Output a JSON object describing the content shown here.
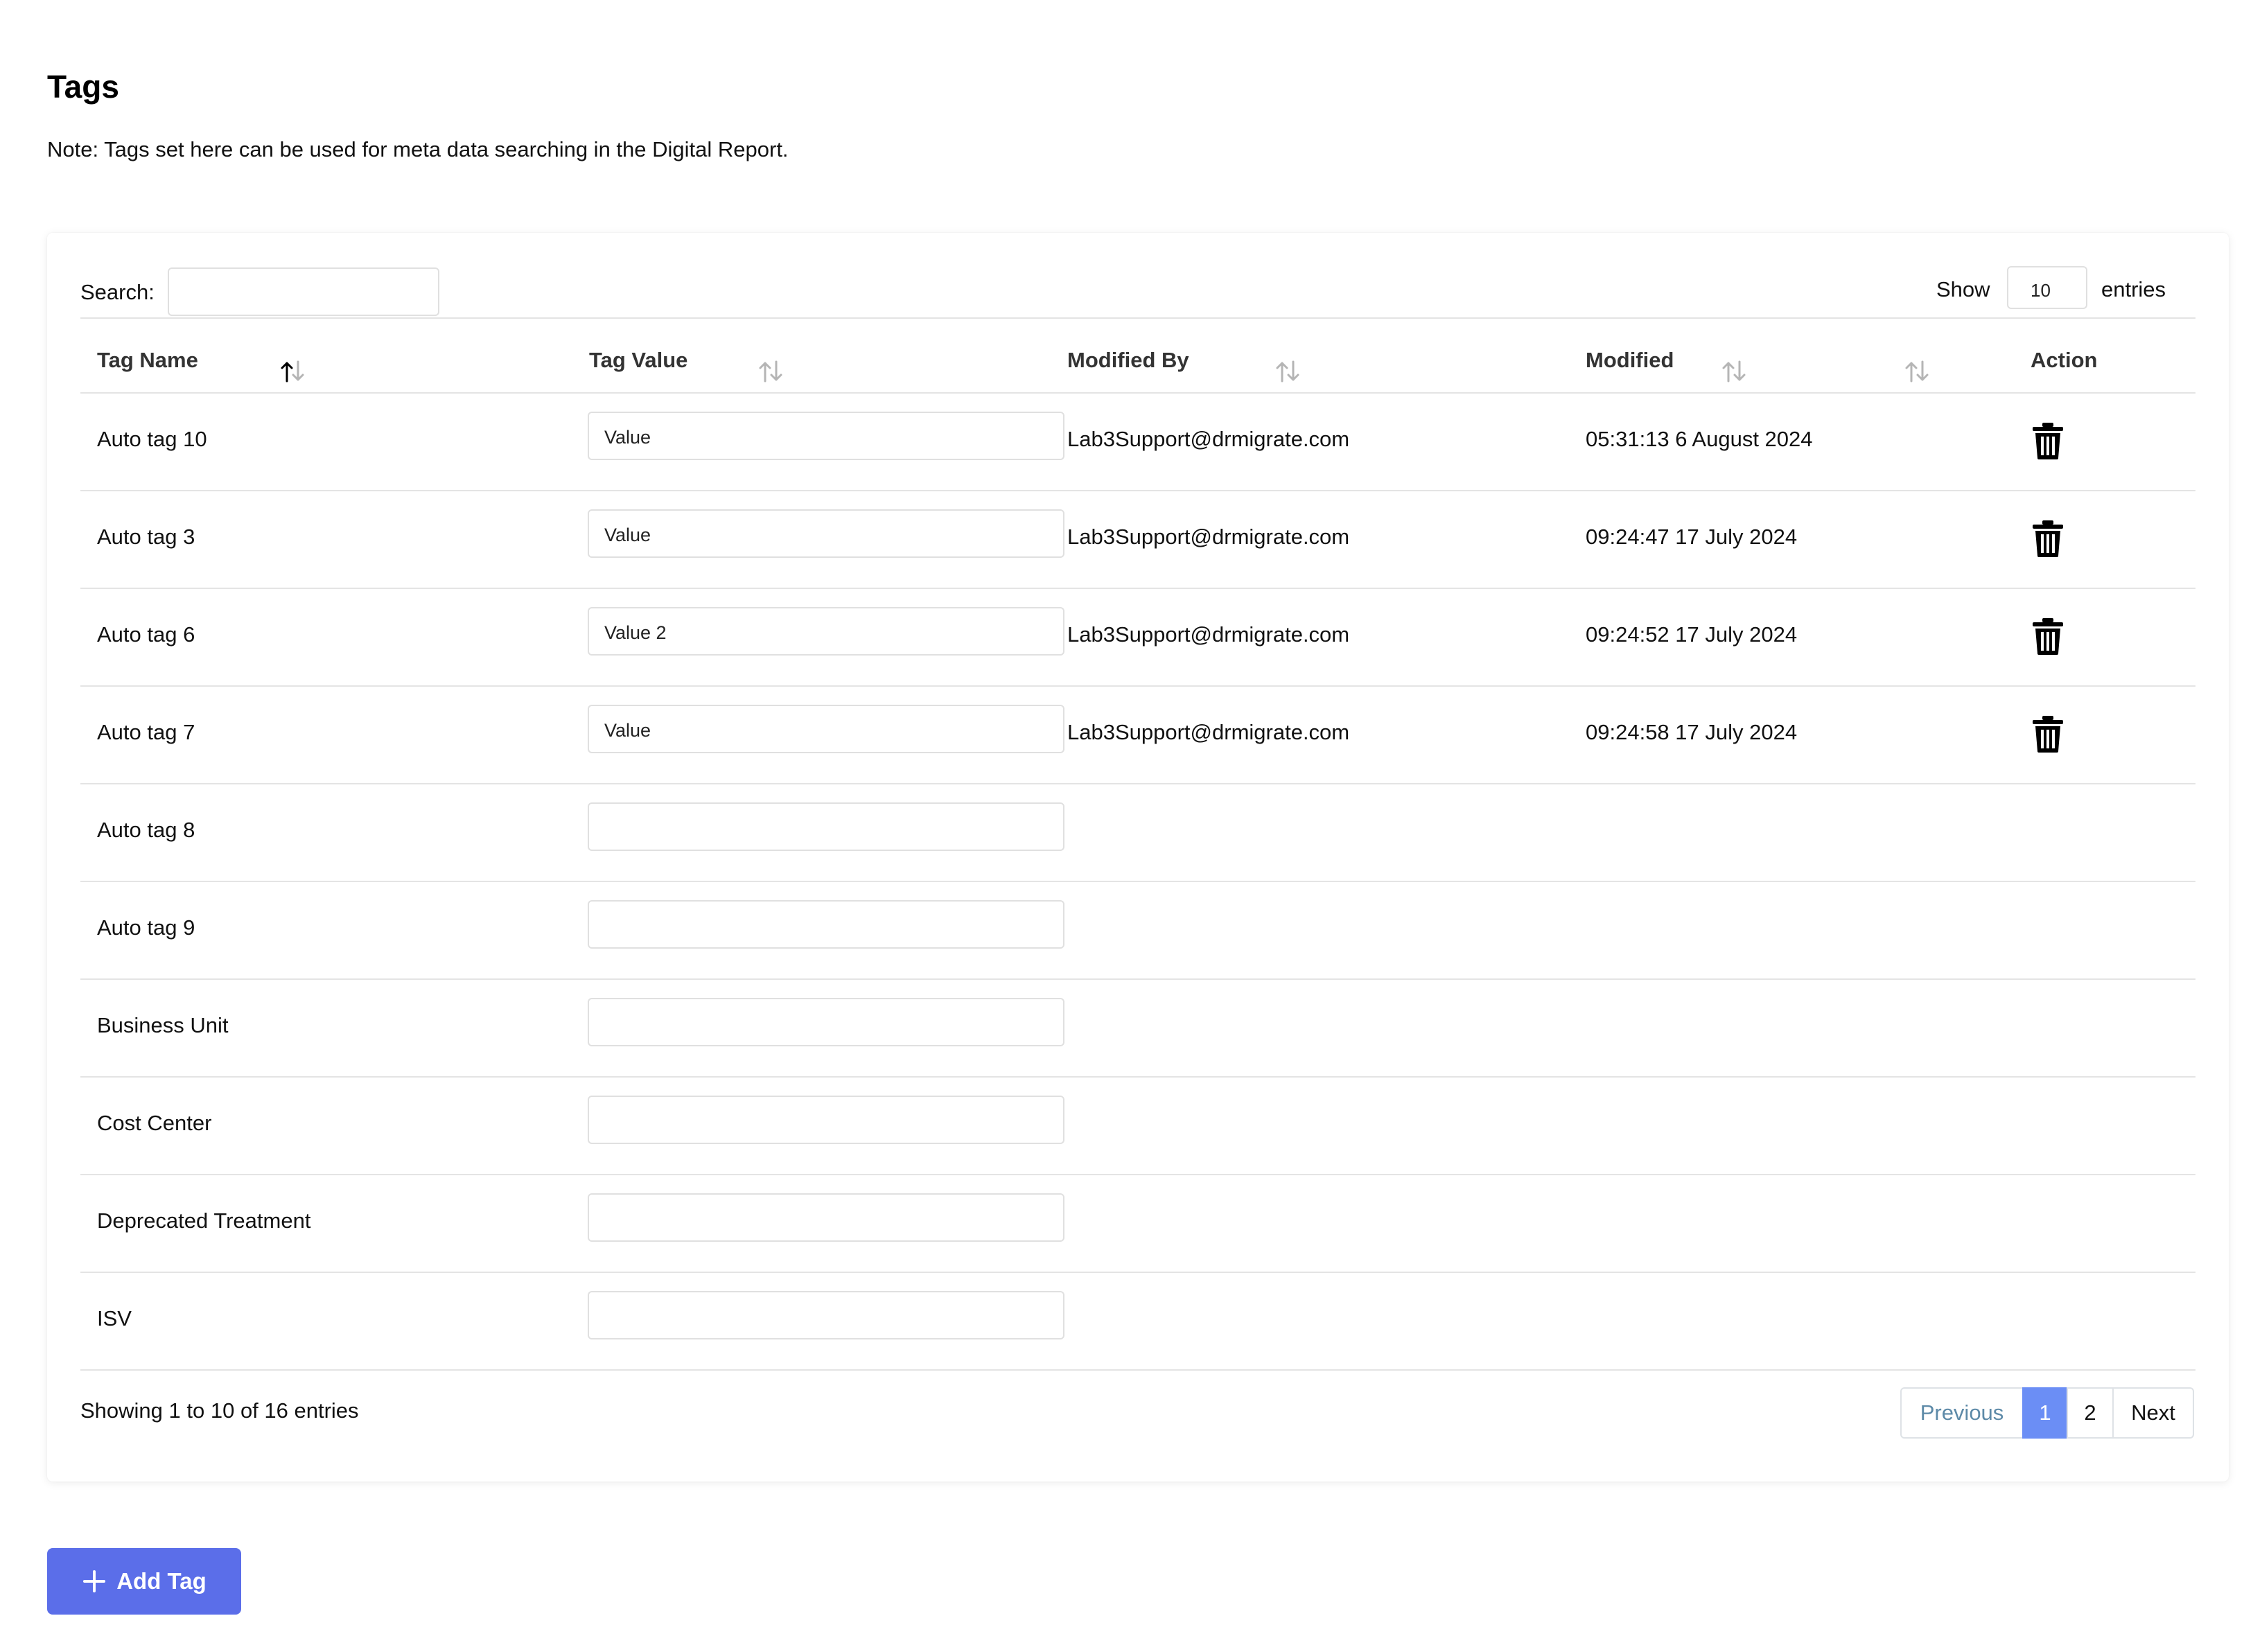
{
  "page": {
    "title": "Tags",
    "note": "Note: Tags set here can be used for meta data searching in the Digital Report."
  },
  "controls": {
    "search_label": "Search:",
    "search_value": "",
    "show_label": "Show",
    "page_size": "10",
    "entries_label": "entries"
  },
  "table": {
    "columns": [
      "Tag Name",
      "Tag Value",
      "Modified By",
      "Modified",
      "Action"
    ],
    "sorted_column": "Tag Name",
    "rows": [
      {
        "name": "Auto tag 10",
        "value": "Value",
        "modified_by": "Lab3Support@drmigrate.com",
        "modified": "05:31:13 6 August 2024",
        "has_delete": true
      },
      {
        "name": "Auto tag 3",
        "value": "Value",
        "modified_by": "Lab3Support@drmigrate.com",
        "modified": "09:24:47 17 July 2024",
        "has_delete": true
      },
      {
        "name": "Auto tag 6",
        "value": "Value 2",
        "modified_by": "Lab3Support@drmigrate.com",
        "modified": "09:24:52 17 July 2024",
        "has_delete": true
      },
      {
        "name": "Auto tag 7",
        "value": "Value",
        "modified_by": "Lab3Support@drmigrate.com",
        "modified": "09:24:58 17 July 2024",
        "has_delete": true
      },
      {
        "name": "Auto tag 8",
        "value": "",
        "modified_by": "",
        "modified": "",
        "has_delete": false
      },
      {
        "name": "Auto tag 9",
        "value": "",
        "modified_by": "",
        "modified": "",
        "has_delete": false
      },
      {
        "name": "Business Unit",
        "value": "",
        "modified_by": "",
        "modified": "",
        "has_delete": false
      },
      {
        "name": "Cost Center",
        "value": "",
        "modified_by": "",
        "modified": "",
        "has_delete": false
      },
      {
        "name": "Deprecated Treatment",
        "value": "",
        "modified_by": "",
        "modified": "",
        "has_delete": false
      },
      {
        "name": "ISV",
        "value": "",
        "modified_by": "",
        "modified": "",
        "has_delete": false
      }
    ],
    "delete_icon": "trash-icon",
    "sort_icon": "sort-arrows-icon"
  },
  "footer": {
    "info": "Showing 1 to 10 of 16 entries",
    "previous_label": "Previous",
    "pages": [
      "1",
      "2"
    ],
    "current_page": "1",
    "next_label": "Next"
  },
  "add_button": {
    "label": "Add Tag",
    "icon": "plus-icon"
  },
  "colors": {
    "accent": "#5b6ee9",
    "active_page": "#6b8ef5",
    "previous_link": "#5d8aa8",
    "border": "#e0e0e0"
  }
}
